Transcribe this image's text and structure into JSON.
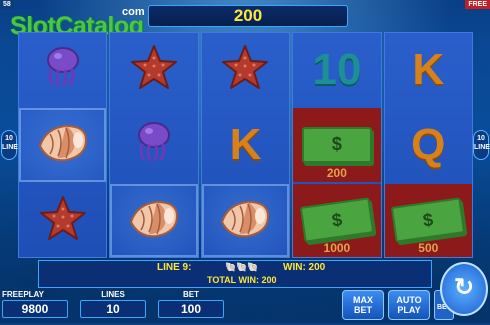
{
  "header": {
    "logo_text": "SlotCatalog",
    "logo_suffix": "com",
    "bet_display": "200",
    "corner_left": "58",
    "corner_right": "FREE"
  },
  "side": {
    "lines_count": "10",
    "lines_label": "LINES"
  },
  "reels": [
    [
      {
        "symbol": "jellyfish-icon"
      },
      {
        "symbol": "conch-shell-icon",
        "win": true
      },
      {
        "symbol": "starfish-icon"
      }
    ],
    [
      {
        "symbol": "starfish-icon"
      },
      {
        "symbol": "jellyfish-icon"
      },
      {
        "symbol": "conch-shell-icon",
        "win": true
      }
    ],
    [
      {
        "symbol": "starfish-icon"
      },
      {
        "symbol": "letter-k-icon",
        "text": "K"
      },
      {
        "symbol": "conch-shell-icon",
        "win": true
      }
    ],
    [
      {
        "symbol": "letter-10-icon",
        "text": "10"
      },
      {
        "symbol": "dollar-bill-icon",
        "payout": "200"
      },
      {
        "symbol": "dollar-bills-icon",
        "payout": "1000"
      }
    ],
    [
      {
        "symbol": "letter-k-icon",
        "text": "K"
      },
      {
        "symbol": "letter-q-icon",
        "text": "Q"
      },
      {
        "symbol": "dollar-bills-icon",
        "payout": "500"
      }
    ]
  ],
  "info": {
    "line_label": "LINE 9:",
    "win_label": "WIN: 200",
    "total_label": "TOTAL WIN: 200"
  },
  "panels": {
    "freeplay_label": "FREEPLAY",
    "freeplay_value": "9800",
    "lines_label": "LINES",
    "lines_value": "10",
    "bet_label": "BET",
    "bet_value": "100"
  },
  "buttons": {
    "max_bet": "MAX BET",
    "auto_play": "AUTO PLAY",
    "bet_minus": "BET"
  }
}
